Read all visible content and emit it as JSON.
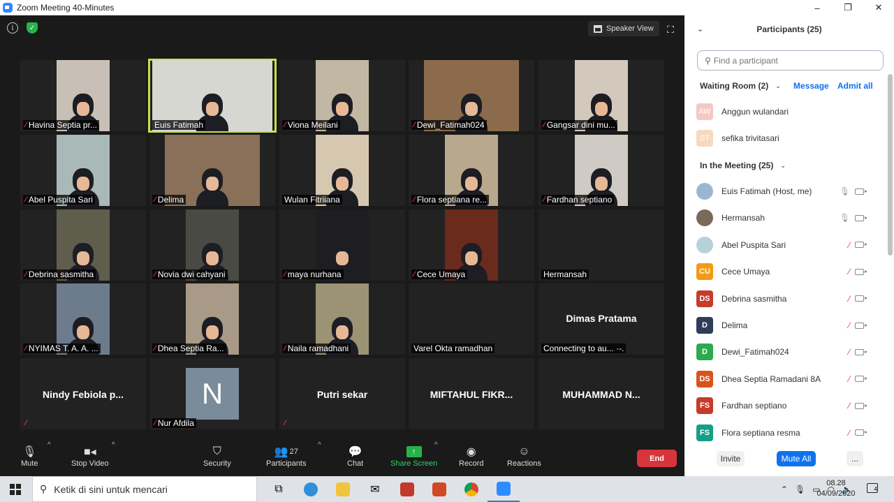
{
  "window": {
    "title": "Zoom Meeting 40-Minutes",
    "controls": [
      "–",
      "❐",
      "✕"
    ]
  },
  "meeting": {
    "view_button": "Speaker View",
    "tiles": [
      {
        "name": "Havina Septia pr...",
        "muted": true,
        "video": true,
        "bg": "#c8c0b6"
      },
      {
        "name": "Euis Fatimah",
        "muted": false,
        "video": true,
        "bg": "#d7d7d2",
        "active": true
      },
      {
        "name": "Viona Meilani",
        "muted": true,
        "video": true,
        "bg": "#c2b7a3"
      },
      {
        "name": "Dewi_Fatimah024",
        "muted": true,
        "video": true,
        "bg": "#8b6b4c"
      },
      {
        "name": "Gangsar dini mu...",
        "muted": true,
        "video": true,
        "bg": "#d2c8bc"
      },
      {
        "name": "Abel Puspita Sari",
        "muted": true,
        "video": true,
        "bg": "#a9b9b8"
      },
      {
        "name": "Delima",
        "muted": true,
        "video": true,
        "bg": "#8a7058"
      },
      {
        "name": "Wulan Fitriiana",
        "muted": false,
        "video": true,
        "bg": "#d6c7b0"
      },
      {
        "name": "Flora septiana re...",
        "muted": true,
        "video": true,
        "bg": "#b8a88e"
      },
      {
        "name": "Fardhan septiano",
        "muted": true,
        "video": true,
        "bg": "#cfcbc4"
      },
      {
        "name": "Debrina sasmitha",
        "muted": true,
        "video": true,
        "bg": "#5f5d4c"
      },
      {
        "name": "Novia dwi cahyani",
        "muted": true,
        "video": true,
        "bg": "#4a4a44"
      },
      {
        "name": "maya nurhana",
        "muted": true,
        "video": true,
        "bg": "#1e1e20"
      },
      {
        "name": "Cece Umaya",
        "muted": true,
        "video": true,
        "bg": "#6a2a1c"
      },
      {
        "name": "Hermansah",
        "muted": false,
        "video": false
      },
      {
        "name": "NYIMAS T. A. A. ...",
        "muted": true,
        "video": true,
        "bg": "#6c7c8c"
      },
      {
        "name": "Dhea Septia Ra...",
        "muted": true,
        "video": true,
        "bg": "#a89a86"
      },
      {
        "name": "Naila ramadhani",
        "muted": true,
        "video": true,
        "bg": "#9c9274"
      },
      {
        "name": "Varel Okta ramadhan",
        "muted": false,
        "video": false
      },
      {
        "name": "Connecting to au... ·-.",
        "muted": false,
        "video": false,
        "bigname": "Dimas Pratama"
      },
      {
        "name": "",
        "muted": true,
        "video": false,
        "bigname": "Nindy  Febiola  p..."
      },
      {
        "name": "Nur Afdila",
        "muted": true,
        "video": false,
        "avatar": "N"
      },
      {
        "name": "",
        "muted": true,
        "video": false,
        "bigname": "Putri sekar"
      },
      {
        "name": "",
        "muted": false,
        "video": false,
        "bigname": "MIFTAHUL  FIKR..."
      },
      {
        "name": "",
        "muted": false,
        "video": false,
        "bigname": "MUHAMMAD  N..."
      }
    ]
  },
  "toolbar": {
    "mute": "Mute",
    "stop_video": "Stop Video",
    "security": "Security",
    "participants": "Participants",
    "participants_count": "27",
    "chat": "Chat",
    "share_screen": "Share Screen",
    "record": "Record",
    "reactions": "Reactions",
    "end": "End"
  },
  "panel": {
    "title": "Participants (25)",
    "search_placeholder": "Find a participant",
    "waiting_room": "Waiting Room (2)",
    "message": "Message",
    "admit_all": "Admit all",
    "waiting": [
      {
        "initials": "AW",
        "name": "Anggun wulandari",
        "color": "#f3c9c4"
      },
      {
        "initials": "ST",
        "name": "sefika trivitasari",
        "color": "#f7d9c0"
      }
    ],
    "in_meeting": "In the Meeting (25)",
    "participants": [
      {
        "initials": "",
        "name": "Euis Fatimah (Host, me)",
        "color": "#9bb7cf",
        "mic_on": true
      },
      {
        "initials": "",
        "name": "Hermansah",
        "color": "#7a6a5a",
        "mic_on": true
      },
      {
        "initials": "",
        "name": "Abel Puspita Sari",
        "color": "#b5d2d8",
        "mic_on": false
      },
      {
        "initials": "CU",
        "name": "Cece Umaya",
        "color": "#f29b13",
        "mic_on": false
      },
      {
        "initials": "DS",
        "name": "Debrina sasmitha",
        "color": "#c63b2b",
        "mic_on": false
      },
      {
        "initials": "D",
        "name": "Delima",
        "color": "#2f3c5a",
        "mic_on": false
      },
      {
        "initials": "D",
        "name": "Dewi_Fatimah024",
        "color": "#2eaa4e",
        "mic_on": false
      },
      {
        "initials": "DS",
        "name": "Dhea Septia Ramadani 8A",
        "color": "#d9541a",
        "mic_on": false
      },
      {
        "initials": "FS",
        "name": "Fardhan septiano",
        "color": "#c63b2b",
        "mic_on": false
      },
      {
        "initials": "FS",
        "name": "Flora septiana resma",
        "color": "#159f86",
        "mic_on": false
      }
    ],
    "invite": "Invite",
    "mute_all": "Mute All",
    "more": "..."
  },
  "taskbar": {
    "search_placeholder": "Ketik di sini untuk mencari",
    "time": "08.28",
    "date": "04/09/2020",
    "notif_count": "4"
  }
}
